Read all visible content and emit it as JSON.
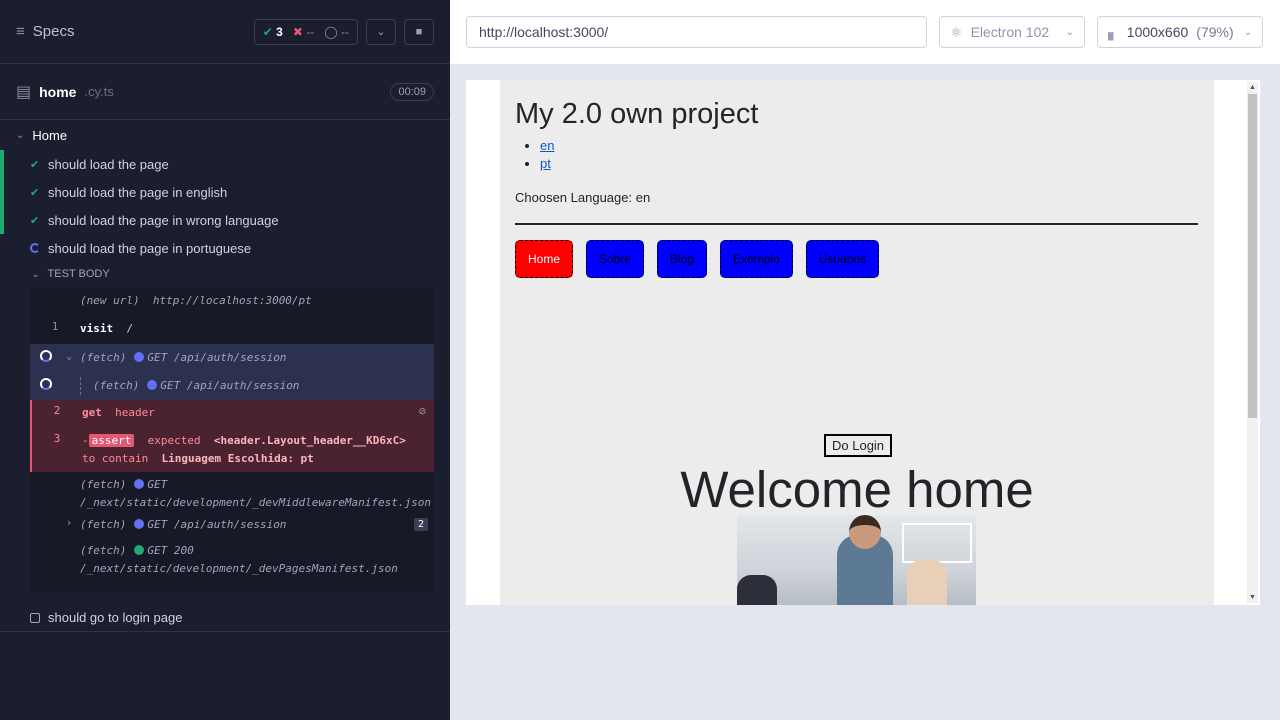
{
  "runner": {
    "specs_label": "Specs",
    "stats": {
      "passed": "3",
      "failed": "--",
      "pending": "--"
    },
    "file": {
      "name": "home",
      "ext": ".cy.ts",
      "duration": "00:09"
    },
    "suite": "Home",
    "tests": [
      {
        "label": "should load the page",
        "state": "passed"
      },
      {
        "label": "should load the page in english",
        "state": "passed"
      },
      {
        "label": "should load the page in wrong language",
        "state": "passed"
      },
      {
        "label": "should load the page in portuguese",
        "state": "running"
      }
    ],
    "test_body_label": "TEST BODY",
    "commands": {
      "new_url": {
        "name": "(new url)",
        "message": "http://localhost:3000/pt"
      },
      "visit": {
        "num": "1",
        "name": "visit",
        "message": "/"
      },
      "fetch1": {
        "name": "(fetch)",
        "message": "GET /api/auth/session"
      },
      "fetch2": {
        "name": "(fetch)",
        "message": "GET /api/auth/session"
      },
      "get": {
        "num": "2",
        "name": "get",
        "message": "header"
      },
      "assert": {
        "num": "3",
        "prefix": "-",
        "badge": "assert",
        "message1": "expected",
        "subject": "<header.Layout_header__KD6xC>",
        "message2": "to",
        "message3": "contain",
        "value": "Linguagem Escolhida: pt"
      },
      "fetch3": {
        "name": "(fetch)",
        "method": "GET",
        "url": "/_next/static/development/_devMiddlewareManifest.json"
      },
      "fetch4": {
        "name": "(fetch)",
        "message": "GET /api/auth/session",
        "count": "2"
      },
      "fetch5": {
        "name": "(fetch)",
        "method": "GET 200",
        "url": "/_next/static/development/_devPagesManifest.json"
      }
    },
    "last_test": "should go to login page"
  },
  "aut": {
    "url": "http://localhost:3000/",
    "browser": "Electron 102",
    "viewport": "1000x660",
    "viewport_pct": "(79%)"
  },
  "app": {
    "title": "My 2.0 own project",
    "languages": [
      "en",
      "pt"
    ],
    "chosen_language": "Choosen Language: en",
    "nav": [
      "Home",
      "Sobre",
      "Blog",
      "Exemplo",
      "Usuarios"
    ],
    "login_button": "Do Login",
    "welcome": "Welcome home"
  },
  "colors": {
    "pass": "#1fa971",
    "fail": "#e45770",
    "running": "#6470f3",
    "nav_active": "#ff0000",
    "nav_default": "#0000ff"
  }
}
